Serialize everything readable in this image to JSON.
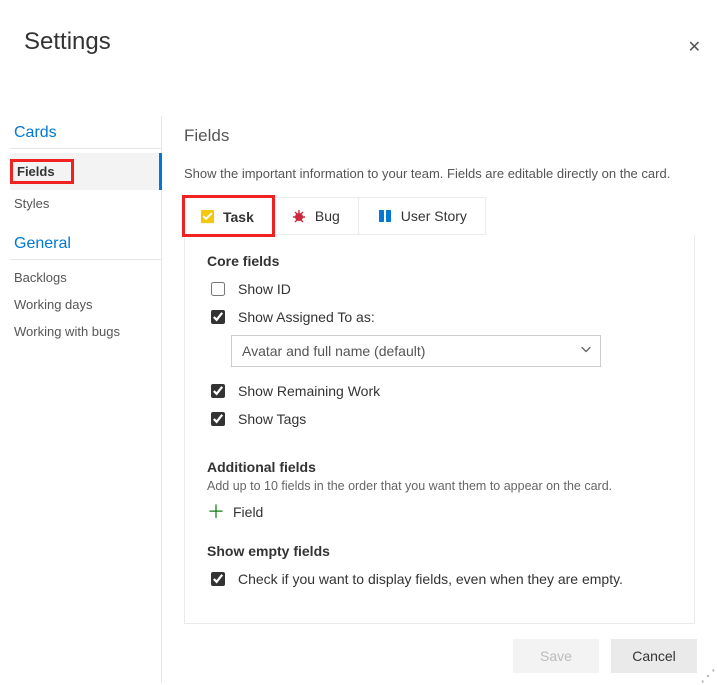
{
  "window": {
    "title": "Settings"
  },
  "sidebar": {
    "sections": [
      {
        "title": "Cards",
        "items": [
          {
            "label": "Fields",
            "active": true,
            "highlighted": true
          },
          {
            "label": "Styles"
          }
        ]
      },
      {
        "title": "General",
        "items": [
          {
            "label": "Backlogs"
          },
          {
            "label": "Working days"
          },
          {
            "label": "Working with bugs"
          }
        ]
      }
    ]
  },
  "main": {
    "heading": "Fields",
    "description": "Show the important information to your team. Fields are editable directly on the card.",
    "tabs": [
      {
        "label": "Task",
        "icon": "task-icon",
        "active": true,
        "highlighted": true
      },
      {
        "label": "Bug",
        "icon": "bug-icon"
      },
      {
        "label": "User Story",
        "icon": "story-icon"
      }
    ],
    "core": {
      "title": "Core fields",
      "show_id": {
        "label": "Show ID",
        "checked": false
      },
      "show_assigned": {
        "label": "Show Assigned To as:",
        "checked": true
      },
      "assigned_select": {
        "value": "Avatar and full name (default)"
      },
      "show_remaining": {
        "label": "Show Remaining Work",
        "checked": true
      },
      "show_tags": {
        "label": "Show Tags",
        "checked": true
      }
    },
    "additional": {
      "title": "Additional fields",
      "subtitle": "Add up to 10 fields in the order that you want them to appear on the card.",
      "add_label": "Field"
    },
    "empty": {
      "title": "Show empty fields",
      "check": {
        "label": "Check if you want to display fields, even when they are empty.",
        "checked": true
      }
    }
  },
  "footer": {
    "save": "Save",
    "cancel": "Cancel"
  }
}
